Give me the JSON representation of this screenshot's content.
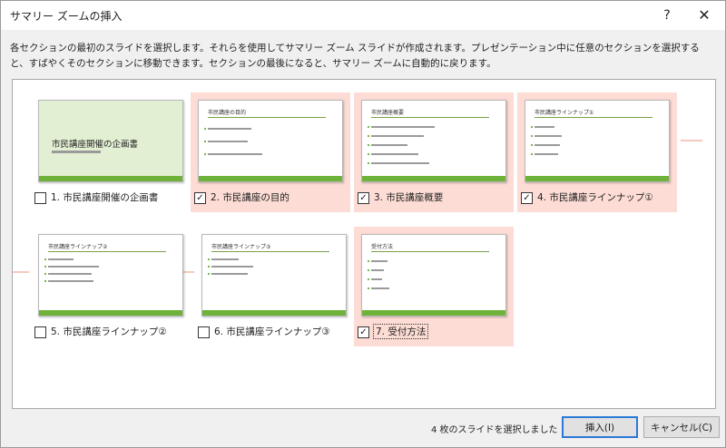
{
  "window": {
    "title": "サマリー ズームの挿入",
    "help_glyph": "?",
    "close_glyph": "✕"
  },
  "description": "各セクションの最初のスライドを選択します。それらを使用してサマリー ズーム スライドが作成されます。プレゼンテーション中に任意のセクションを選択すると、すばやくそのセクションに移動できます。セクションの最後になると、サマリー ズームに自動的に戻ります。",
  "sections": [
    {
      "label": "1. 市民講座開催の企画書",
      "checked": false,
      "slide_title": "市民講座開催の企画書"
    },
    {
      "label": "2. 市民講座の目的",
      "checked": true,
      "slide_title": "市民講座の目的"
    },
    {
      "label": "3. 市民講座概要",
      "checked": true,
      "slide_title": "市民講座概要"
    },
    {
      "label": "4. 市民講座ラインナップ①",
      "checked": true,
      "slide_title": "市民講座ラインナップ①"
    },
    {
      "label": "5. 市民講座ラインナップ②",
      "checked": false,
      "slide_title": "市民講座ラインナップ②"
    },
    {
      "label": "6. 市民講座ラインナップ③",
      "checked": false,
      "slide_title": "市民講座ラインナップ③"
    },
    {
      "label": "7. 受付方法",
      "checked": true,
      "slide_title": "受付方法"
    }
  ],
  "checkmark_glyph": "✓",
  "colors": {
    "selected_bg": "#fcdcd4",
    "slide_accent": "#6fb23a",
    "cover_bg": "#e3efd2",
    "default_button_border": "#2b79d8"
  },
  "footer": {
    "status": "4 枚のスライドを選択しました",
    "insert_button": "挿入(I)",
    "cancel_button": "キャンセル(C)"
  }
}
